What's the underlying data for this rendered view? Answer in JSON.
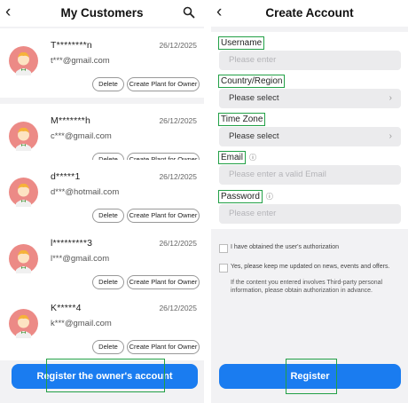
{
  "customers_screen": {
    "back_icon": "chevron-left-icon",
    "title": "My Customers",
    "search_icon": "search-icon",
    "customers": [
      {
        "name": "T********n",
        "date": "26/12/2025",
        "email": "t***@gmail.com"
      },
      {
        "name": "M*******h",
        "date": "26/12/2025",
        "email": "c***@gmail.com"
      },
      {
        "name": "d*****1",
        "date": "26/12/2025",
        "email": "d***@hotmail.com"
      },
      {
        "name": "l*********3",
        "date": "26/12/2025",
        "email": "l***@gmail.com"
      },
      {
        "name": "K*****4",
        "date": "26/12/2025",
        "email": "k***@gmail.com"
      }
    ],
    "delete_label": "Delete",
    "create_plant_label": "Create Plant for Owner",
    "register_owner_label": "Register the owner's account"
  },
  "create_account_screen": {
    "back_icon": "chevron-left-icon",
    "title": "Create Account",
    "username_label": "Username",
    "username_placeholder": "Please enter",
    "country_label": "Country/Region",
    "country_value": "Please select",
    "timezone_label": "Time Zone",
    "timezone_value": "Please select",
    "email_label": "Email",
    "email_placeholder": "Please enter a valid Email",
    "password_label": "Password",
    "password_placeholder": "Please enter",
    "authorization_text": "I have obtained the user's authorization",
    "updates_text": "Yes, please keep me updated on news, events and offers.",
    "note_text": "If the content you entered involves Third-party personal information, please obtain authorization in advance.",
    "register_label": "Register"
  },
  "colors": {
    "accent": "#1a7cf0",
    "highlight": "#22a046",
    "background": "#f2f2f4"
  }
}
